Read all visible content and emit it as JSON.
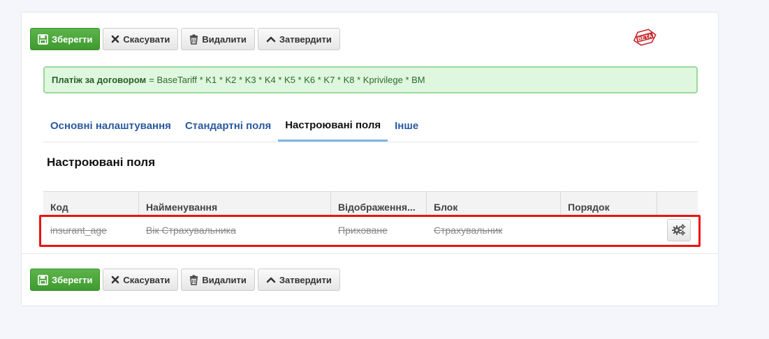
{
  "toolbar": {
    "save_label": "Зберегти",
    "cancel_label": "Скасувати",
    "delete_label": "Видалити",
    "approve_label": "Затвердити"
  },
  "badge": {
    "label": "BETA",
    "color": "#c8262b"
  },
  "formula": {
    "label": "Платіж за договором",
    "expression": "= BaseTariff * K1 * K2 * K3 * K4 * K5 * K6 * K7 * K8 * Kprivilege * BM"
  },
  "tabs": [
    {
      "label": "Основні налаштування",
      "active": false
    },
    {
      "label": "Стандартні поля",
      "active": false
    },
    {
      "label": "Настроювані поля",
      "active": true
    },
    {
      "label": "Інше",
      "active": false
    }
  ],
  "section": {
    "title": "Настроювані поля"
  },
  "grid": {
    "columns": [
      "Код",
      "Найменування",
      "Відображення...",
      "Блок",
      "Порядок",
      ""
    ],
    "rows": [
      {
        "code": "insurant_age",
        "name": "Вік Страхувальника",
        "display": "Приховане",
        "block": "Страхувальник",
        "order": "",
        "deleted": true
      }
    ]
  },
  "colors": {
    "save_button": "#4aa93a",
    "formula_bg": "#dff7df",
    "tab_link": "#2a5aa0",
    "tab_active_underline": "#7fb6e6",
    "highlight_border": "#ee1111"
  },
  "icons": {
    "save": "floppy-disk-icon",
    "cancel": "x-icon",
    "delete": "trash-icon",
    "approve": "chevron-up-icon",
    "row_action": "gears-icon"
  }
}
